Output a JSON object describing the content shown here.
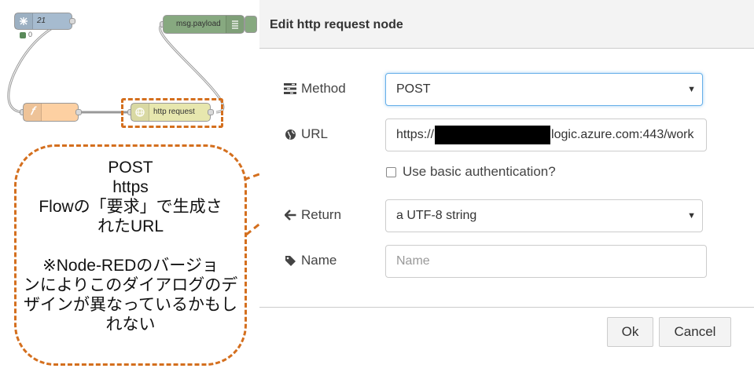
{
  "flow": {
    "inject": {
      "label": "21",
      "status": "0"
    },
    "debug": {
      "label": "msg.payload"
    },
    "http_node": {
      "label": "http request"
    }
  },
  "callout": {
    "lines": [
      "POST",
      "https",
      "Flowの「要求」で生成さ",
      "れたURL",
      "",
      "※Node-REDのバージョ",
      "ンによりこのダイアログのデ",
      "ザインが異なっているかもし",
      "れない"
    ]
  },
  "dialog": {
    "title": "Edit http request node",
    "method": {
      "label": "Method",
      "value": "POST"
    },
    "url": {
      "label": "URL",
      "value_prefix": "https://",
      "value_suffix": "logic.azure.com:443/work"
    },
    "basic_auth": {
      "label": "Use basic authentication?",
      "checked": false
    },
    "return": {
      "label": "Return",
      "value": "a UTF-8 string"
    },
    "name": {
      "label": "Name",
      "placeholder": "Name"
    },
    "buttons": {
      "ok": "Ok",
      "cancel": "Cancel"
    }
  },
  "colors": {
    "accent_dashed": "#d46f1e",
    "inject_node": "#a6bbcf",
    "debug_node": "#87a980",
    "function_node": "#fdd0a2",
    "http_node": "#e7e7ae"
  }
}
